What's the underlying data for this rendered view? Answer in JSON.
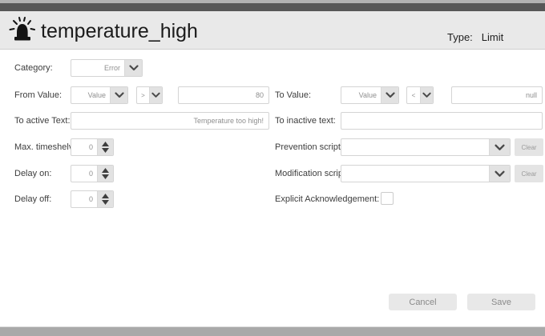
{
  "window": {
    "title": "temperature_high",
    "type_label": "Type:",
    "type_value": "Limit"
  },
  "form": {
    "category": {
      "label": "Category:",
      "value": "Error"
    },
    "from_value": {
      "label": "From Value:",
      "source": "Value",
      "operator": ">",
      "value": "80"
    },
    "to_value": {
      "label": "To Value:",
      "source": "Value",
      "operator": "<",
      "value": "null"
    },
    "to_active_text": {
      "label": "To active Text:",
      "value": "Temperature too high!"
    },
    "to_inactive_text": {
      "label": "To inactive text:",
      "value": ""
    },
    "max_timeshelve": {
      "label": "Max. timeshelve:",
      "value": "0"
    },
    "prevention_script": {
      "label": "Prevention script:",
      "value": "",
      "clear_label": "Clear"
    },
    "delay_on": {
      "label": "Delay on:",
      "value": "0"
    },
    "modification_script": {
      "label": "Modification script:",
      "value": "",
      "clear_label": "Clear"
    },
    "delay_off": {
      "label": "Delay off:",
      "value": "0"
    },
    "explicit_acknowledgement": {
      "label": "Explicit Acknowledgement:",
      "checked": false
    }
  },
  "footer": {
    "cancel_label": "Cancel",
    "save_label": "Save"
  },
  "colors": {
    "top_bar": "#575757",
    "header_bg": "#e9e9e9",
    "bottom_bar": "#a9a9a9",
    "control_border": "#d4d4d4",
    "control_btn_bg": "#e2e2e2",
    "button_bg": "#e8e8e8"
  }
}
